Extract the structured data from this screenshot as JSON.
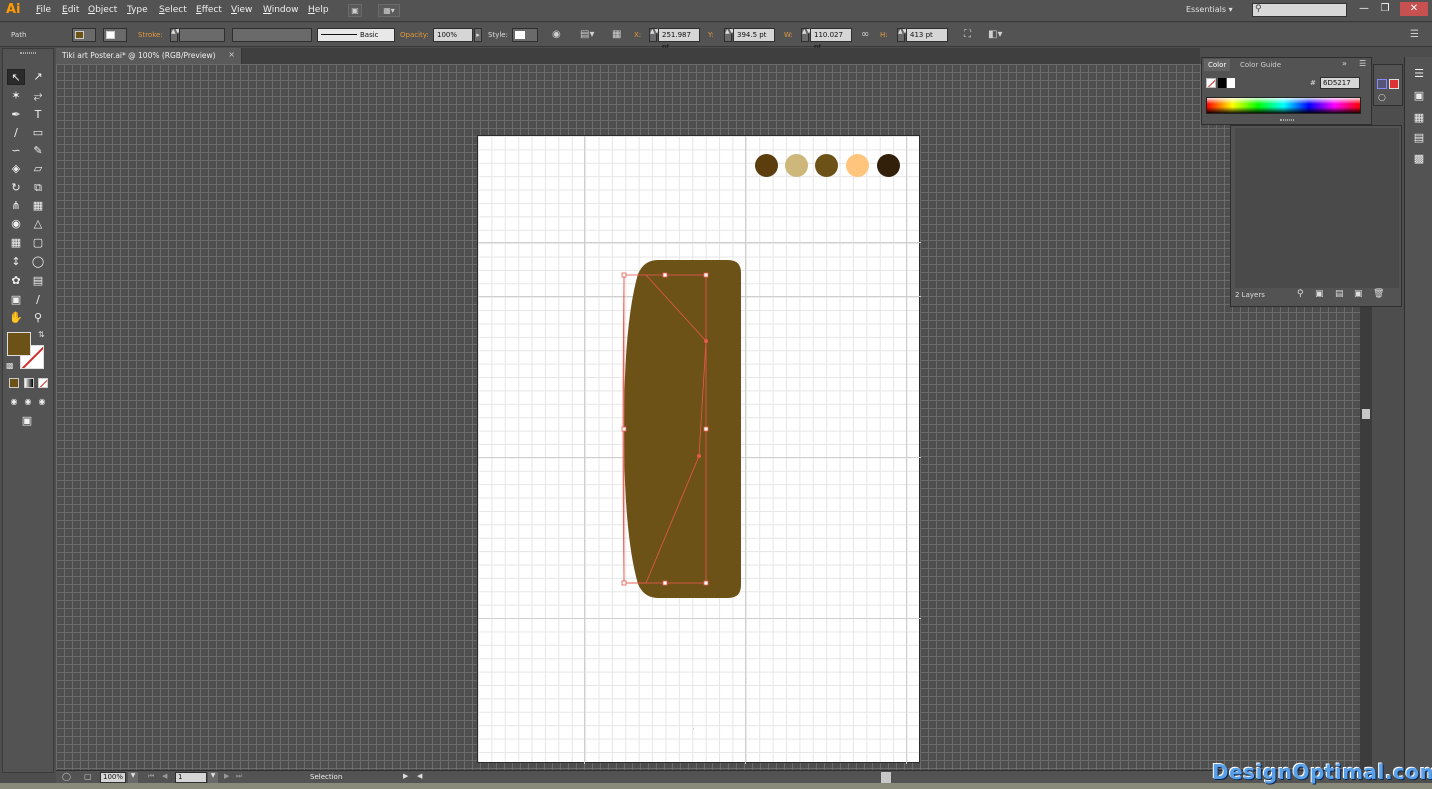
{
  "app": {
    "logo": "Ai"
  },
  "menu": [
    "File",
    "Edit",
    "Object",
    "Type",
    "Select",
    "Effect",
    "View",
    "Window",
    "Help"
  ],
  "workspace": "Essentials",
  "window_buttons": [
    "—",
    "❐",
    "✕"
  ],
  "control_bar": {
    "selection_type": "Path",
    "stroke_label": "Stroke:",
    "brush_label": "Basic",
    "opacity_label": "Opacity:",
    "opacity_value": "100%",
    "style_label": "Style:",
    "x_label": "X:",
    "x_value": "251.987 pt",
    "y_label": "Y:",
    "y_value": "394.5 pt",
    "w_label": "W:",
    "w_value": "110.027 pt",
    "h_label": "H:",
    "h_value": "413 pt"
  },
  "document_tab": {
    "title": "Tiki art Poster.ai* @ 100% (RGB/Preview)",
    "close": "×"
  },
  "tools": [
    "selection-tool",
    "direct-selection-tool",
    "magic-wand-tool",
    "lasso-tool",
    "pen-tool",
    "type-tool",
    "line-tool",
    "ellipse-tool",
    "paintbrush-tool",
    "pencil-tool",
    "blob-brush-tool",
    "eraser-tool",
    "rotate-tool",
    "scale-tool",
    "width-tool",
    "free-transform-tool",
    "shape-builder-tool",
    "perspective-grid-tool",
    "mesh-tool",
    "gradient-tool",
    "eyedropper-tool",
    "blend-tool",
    "symbol-sprayer-tool",
    "column-graph-tool",
    "artboard-tool",
    "slice-tool",
    "hand-tool",
    "zoom-tool"
  ],
  "fill_color": "#6d5217",
  "palette_swatches": [
    "#5b3d0e",
    "#cdb77a",
    "#6d5217",
    "#ffc57c",
    "#33200a"
  ],
  "shape": {
    "fill": "#6d5217",
    "selection_color": "#e8584e"
  },
  "color_panel": {
    "tabs": [
      "Color",
      "Color Guide"
    ],
    "hex_label": "#",
    "hex_value": "6D5217"
  },
  "layers_panel": {
    "count_label": "2 Layers"
  },
  "status_bar": {
    "zoom": "100%",
    "artboard_number": "1",
    "status": "Selection"
  },
  "watermark": "DesignOptimal.com"
}
